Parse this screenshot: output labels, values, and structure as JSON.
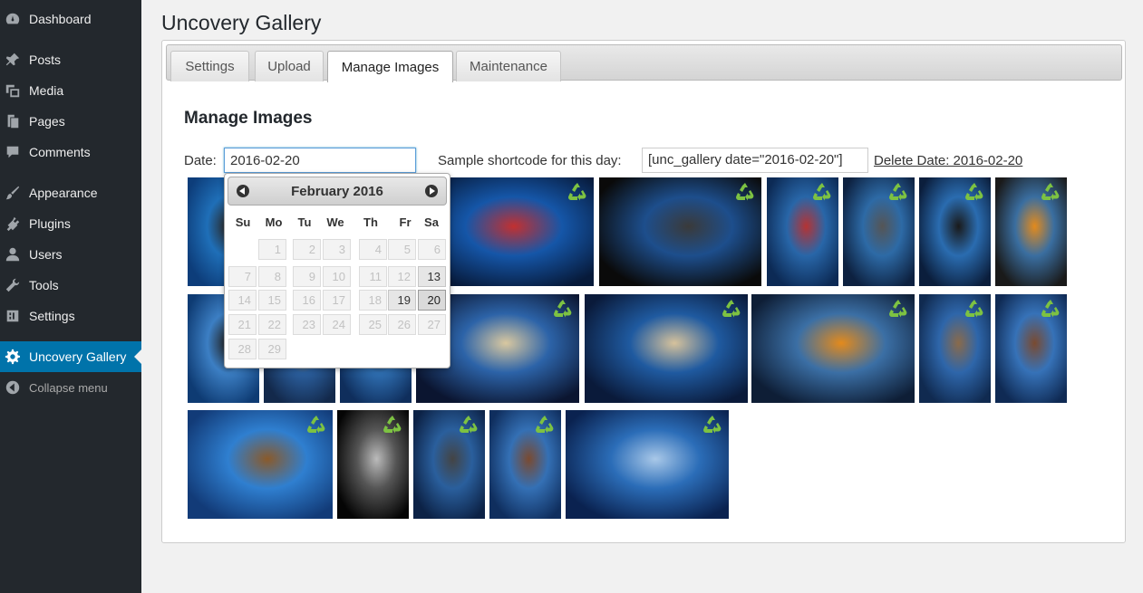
{
  "sidebar": {
    "items": [
      {
        "label": "Dashboard",
        "icon": "dashboard-icon"
      },
      {
        "label": "Posts",
        "icon": "pin-icon"
      },
      {
        "label": "Media",
        "icon": "media-icon"
      },
      {
        "label": "Pages",
        "icon": "pages-icon"
      },
      {
        "label": "Comments",
        "icon": "comment-icon"
      },
      {
        "label": "Appearance",
        "icon": "brush-icon"
      },
      {
        "label": "Plugins",
        "icon": "plugin-icon"
      },
      {
        "label": "Users",
        "icon": "user-icon"
      },
      {
        "label": "Tools",
        "icon": "wrench-icon"
      },
      {
        "label": "Settings",
        "icon": "settings-icon"
      },
      {
        "label": "Uncovery Gallery",
        "icon": "gear-icon",
        "active": true
      }
    ],
    "collapse_label": "Collapse menu"
  },
  "page": {
    "title": "Uncovery Gallery",
    "tabs": [
      {
        "label": "Settings"
      },
      {
        "label": "Upload"
      },
      {
        "label": "Manage Images",
        "active": true
      },
      {
        "label": "Maintenance"
      }
    ],
    "section_heading": "Manage Images",
    "date_label": "Date:",
    "date_value": "2016-02-20",
    "shortcode_label": "Sample shortcode for this day:",
    "shortcode_value": "[unc_gallery date=\"2016-02-20\"]",
    "delete_label": "Delete Date: 2016-02-20"
  },
  "datepicker": {
    "month_title": "February 2016",
    "weekdays": [
      "Su",
      "Mo",
      "Tu",
      "We",
      "Th",
      "Fr",
      "Sa"
    ],
    "days": [
      "1",
      "2",
      "3",
      "4",
      "5",
      "6",
      "7",
      "8",
      "9",
      "10",
      "11",
      "12",
      "13",
      "14",
      "15",
      "16",
      "17",
      "18",
      "19",
      "20",
      "21",
      "22",
      "23",
      "24",
      "25",
      "26",
      "27",
      "28",
      "29"
    ],
    "enabled_days": [
      "13",
      "19",
      "20"
    ],
    "selected_day": "20"
  },
  "thumbnails": [
    {
      "row": 1,
      "subject": "guitarist"
    },
    {
      "row": 1,
      "subject": "singer with guitar"
    },
    {
      "row": 1,
      "subject": "singer at microphone"
    },
    {
      "row": 1,
      "subject": "bass player"
    },
    {
      "row": 1,
      "subject": "drummer"
    },
    {
      "row": 1,
      "subject": "guitarist"
    },
    {
      "row": 1,
      "subject": "guitarist in front of sign"
    },
    {
      "row": 2,
      "subject": "guitarist"
    },
    {
      "row": 2,
      "subject": "guitar"
    },
    {
      "row": 2,
      "subject": "singer"
    },
    {
      "row": 2,
      "subject": "singer"
    },
    {
      "row": 2,
      "subject": "singer with microphone"
    },
    {
      "row": 2,
      "subject": "singer with microphone"
    },
    {
      "row": 2,
      "subject": "band on stage"
    },
    {
      "row": 2,
      "subject": "violinist"
    },
    {
      "row": 2,
      "subject": "violinist"
    },
    {
      "row": 3,
      "subject": "violinist"
    },
    {
      "row": 3,
      "subject": "bass player black and white"
    },
    {
      "row": 3,
      "subject": "drummer"
    },
    {
      "row": 3,
      "subject": "violinist"
    },
    {
      "row": 3,
      "subject": "singer at microphone"
    }
  ],
  "colors": {
    "sidebar_bg": "#23282d",
    "active_menu": "#0073aa",
    "recycle_icon": "#7dc242"
  }
}
